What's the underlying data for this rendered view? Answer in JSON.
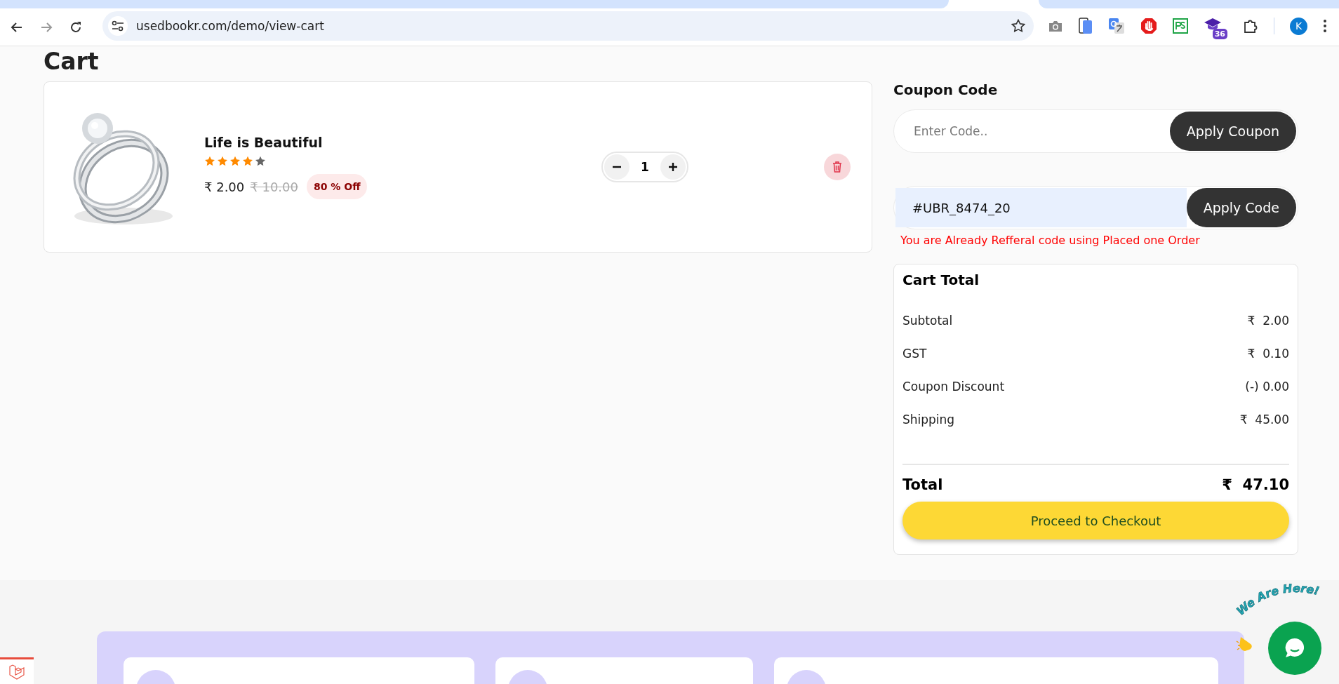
{
  "browser": {
    "url": "usedbookr.com/demo/view-cart",
    "extension_badge": "36",
    "profile_initial": "K"
  },
  "heading": "Cart",
  "cart_items": [
    {
      "name": "Life is Beautiful",
      "stars": 4,
      "price": "₹ 2.00",
      "old_price": "₹ 10.00",
      "discount": "80 % Off",
      "quantity": "1"
    }
  ],
  "coupon": {
    "title": "Coupon Code",
    "placeholder": "Enter Code..",
    "button": "Apply Coupon"
  },
  "referral": {
    "value": "#UBR_8474_20",
    "button": "Apply Code",
    "error": "You are Already Refferal code using Placed one Order"
  },
  "cart_total": {
    "title": "Cart Total",
    "rows": [
      {
        "label": "Subtotal",
        "value": "₹  2.00"
      },
      {
        "label": "GST",
        "value": "₹  0.10"
      },
      {
        "label": "Coupon Discount",
        "value": "(-) 0.00"
      },
      {
        "label": "Shipping",
        "value": "₹  45.00"
      }
    ],
    "total_label": "Total",
    "total_value": "₹  47.10",
    "checkout_button": "Proceed to Checkout"
  },
  "chat": {
    "tagline": "We Are Here!"
  }
}
